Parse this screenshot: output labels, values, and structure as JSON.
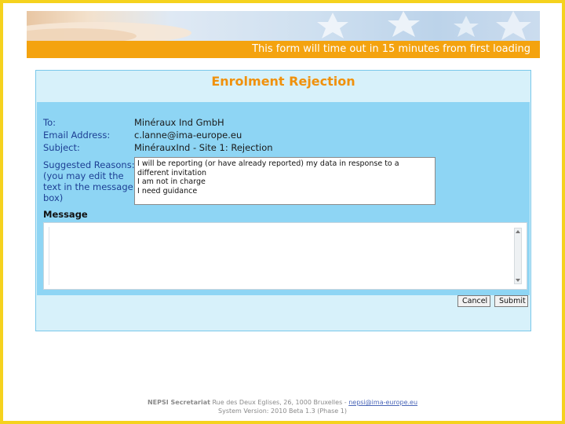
{
  "banner": {
    "timeout_text": "This form will time out in 15 minutes from first loading"
  },
  "form": {
    "title": "Enrolment Rejection",
    "fields": {
      "to_label": "To:",
      "to_value": "Minéraux Ind GmbH",
      "email_label": "Email Address:",
      "email_value": "c.lanne@ima-europe.eu",
      "subject_label": "Subject:",
      "subject_value": "MinérauxInd - Site 1: Rejection",
      "reasons_label_1": "Suggested Reasons:",
      "reasons_label_2": "(you may edit the",
      "reasons_label_3": "text in the message",
      "reasons_label_4": "box)"
    },
    "reasons": [
      "I will be reporting (or have already reported) my data in response to a different invitation",
      "I am not in charge",
      "I need guidance"
    ],
    "message_label": "Message",
    "message_value": "",
    "cancel_label": "Cancel",
    "submit_label": "Submit"
  },
  "footer": {
    "org": "NEPSI Secretariat",
    "address": " Rue des Deux Eglises, 26, 1000 Bruxelles - ",
    "email": "nepsi@ima-europe.eu",
    "version": "System Version: 2010 Beta 1.3 (Phase 1)"
  },
  "colors": {
    "frame": "#f5d21e",
    "orange_bar": "#f4a30f",
    "title": "#f0910c",
    "panel": "#8ed5f4",
    "label": "#1d3f94"
  }
}
